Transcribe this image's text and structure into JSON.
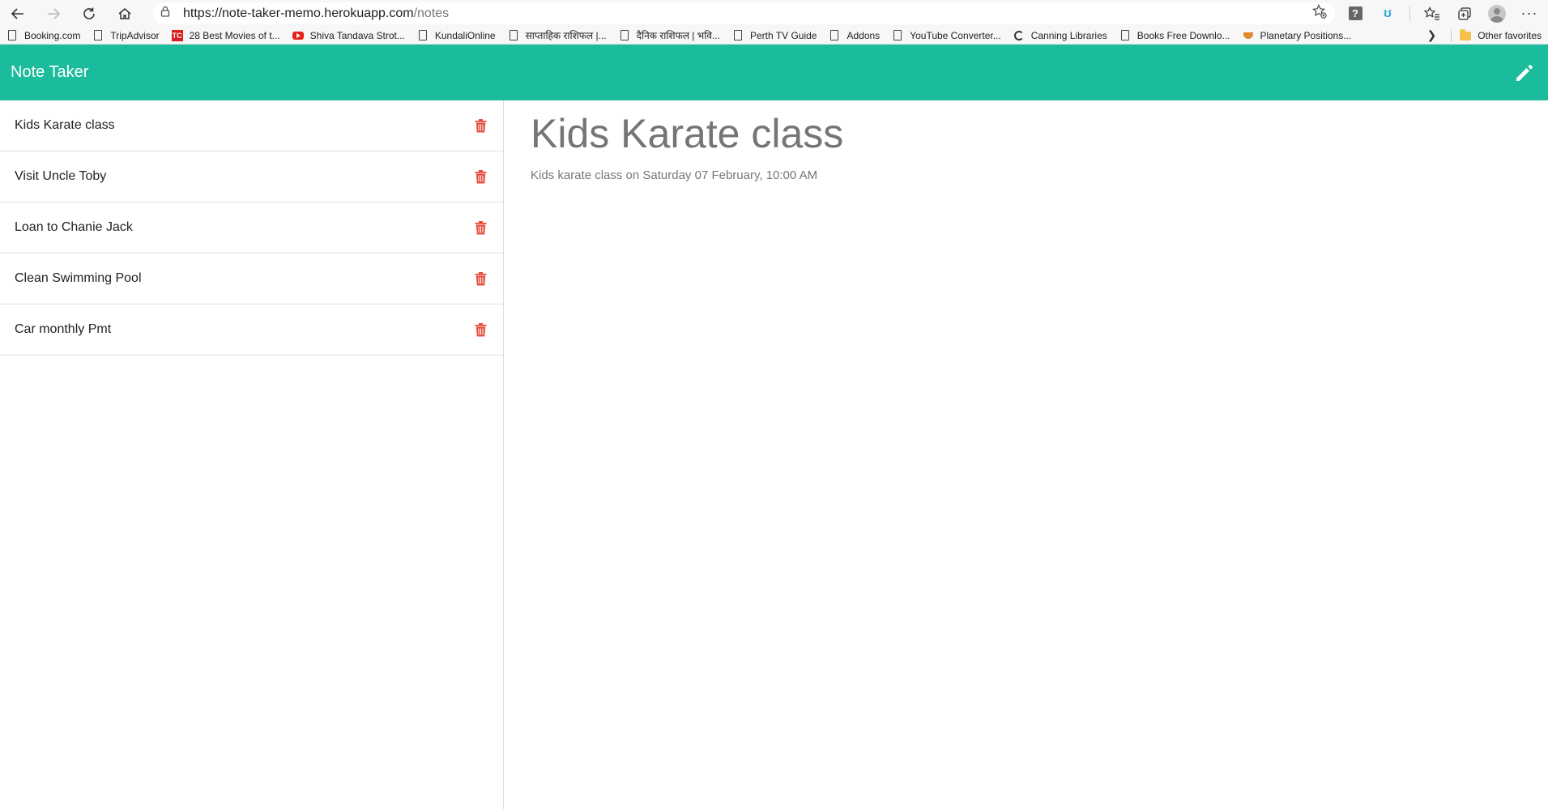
{
  "browser": {
    "url_host": "https://note-taker-memo.herokuapp.com",
    "url_path": "/notes",
    "help_ext_label": "?",
    "blue_ext_label": "ʊ",
    "more_label": "···",
    "bookmarks": [
      {
        "label": "Booking.com",
        "icon": "page-icon"
      },
      {
        "label": "TripAdvisor",
        "icon": "page-icon"
      },
      {
        "label": "28 Best Movies of t...",
        "icon": "tc-icon"
      },
      {
        "label": "Shiva Tandava Strot...",
        "icon": "youtube-icon"
      },
      {
        "label": "KundaliOnline",
        "icon": "page-icon"
      },
      {
        "label": "साप्ताहिक राशिफल |...",
        "icon": "page-icon"
      },
      {
        "label": "दैनिक राशिफल | भवि...",
        "icon": "page-icon"
      },
      {
        "label": "Perth TV Guide",
        "icon": "page-icon"
      },
      {
        "label": "Addons",
        "icon": "page-icon"
      },
      {
        "label": "YouTube Converter...",
        "icon": "page-icon"
      },
      {
        "label": "Canning Libraries",
        "icon": "circle-icon"
      },
      {
        "label": "Books Free Downlo...",
        "icon": "page-icon"
      },
      {
        "label": "Planetary Positions...",
        "icon": "sun-icon"
      }
    ],
    "tc_icon_text": "TC",
    "other_favorites": "Other favorites"
  },
  "app": {
    "brand": "Note Taker",
    "notes": [
      {
        "title": "Kids Karate class"
      },
      {
        "title": "Visit Uncle Toby"
      },
      {
        "title": "Loan to Chanie Jack"
      },
      {
        "title": "Clean Swimming Pool"
      },
      {
        "title": "Car monthly Pmt"
      }
    ],
    "active_note": {
      "title": "Kids Karate class",
      "text": "Kids karate class on Saturday 07 February, 10:00 AM"
    }
  },
  "colors": {
    "navbar": "#1abc9c",
    "delete_icon": "#e74c3c",
    "title_text": "#757575"
  }
}
